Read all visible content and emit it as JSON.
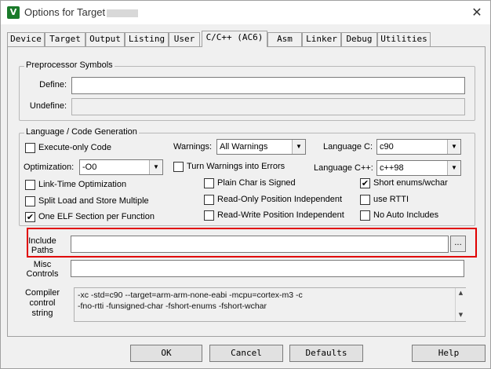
{
  "window": {
    "title": "Options for Target",
    "app_icon": "keil-icon",
    "close_glyph": "✕"
  },
  "tabs": [
    {
      "label": "Device"
    },
    {
      "label": "Target"
    },
    {
      "label": "Output"
    },
    {
      "label": "Listing"
    },
    {
      "label": "User"
    },
    {
      "label": "C/C++ (AC6)",
      "active": true
    },
    {
      "label": "Asm"
    },
    {
      "label": "Linker"
    },
    {
      "label": "Debug"
    },
    {
      "label": "Utilities"
    }
  ],
  "preprocessor": {
    "title": "Preprocessor Symbols",
    "define_label": "Define:",
    "define_value": "",
    "undefine_label": "Undefine:",
    "undefine_value": ""
  },
  "language": {
    "title": "Language / Code Generation",
    "execute_only": {
      "label": "Execute-only Code",
      "checked": false
    },
    "optimization_label": "Optimization:",
    "optimization_value": "-O0",
    "lto": {
      "label": "Link-Time Optimization",
      "checked": false
    },
    "split_load": {
      "label": "Split Load and Store Multiple",
      "checked": false
    },
    "one_elf": {
      "label": "One ELF Section per Function",
      "checked": true
    },
    "warnings_label": "Warnings:",
    "warnings_value": "All Warnings",
    "turn_warnings": {
      "label": "Turn Warnings into Errors",
      "checked": false
    },
    "plain_char": {
      "label": "Plain Char is Signed",
      "checked": false
    },
    "ropi": {
      "label": "Read-Only Position Independent",
      "checked": false
    },
    "rwpi": {
      "label": "Read-Write Position Independent",
      "checked": false
    },
    "lang_c_label": "Language C:",
    "lang_c_value": "c90",
    "lang_cpp_label": "Language C++:",
    "lang_cpp_value": "c++98",
    "short_enums": {
      "label": "Short enums/wchar",
      "checked": true
    },
    "use_rtti": {
      "label": "use RTTI",
      "checked": false
    },
    "no_auto_includes": {
      "label": "No Auto Includes",
      "checked": false
    }
  },
  "include": {
    "label_line1": "Include",
    "label_line2": "Paths",
    "value": "",
    "browse_label": "..."
  },
  "misc": {
    "label_line1": "Misc",
    "label_line2": "Controls",
    "value": ""
  },
  "compiler": {
    "label_line1": "Compiler",
    "label_line2": "control",
    "label_line3": "string",
    "line1": "-xc -std=c90 --target=arm-arm-none-eabi -mcpu=cortex-m3 -c",
    "line2": "-fno-rtti -funsigned-char -fshort-enums -fshort-wchar"
  },
  "buttons": {
    "ok": "OK",
    "cancel": "Cancel",
    "defaults": "Defaults",
    "help": "Help"
  },
  "check_glyph": "✔",
  "arrow_glyph": "▼",
  "scroll_up_glyph": "▲",
  "scroll_down_glyph": "▼",
  "colors": {
    "highlight": "#e00000"
  }
}
